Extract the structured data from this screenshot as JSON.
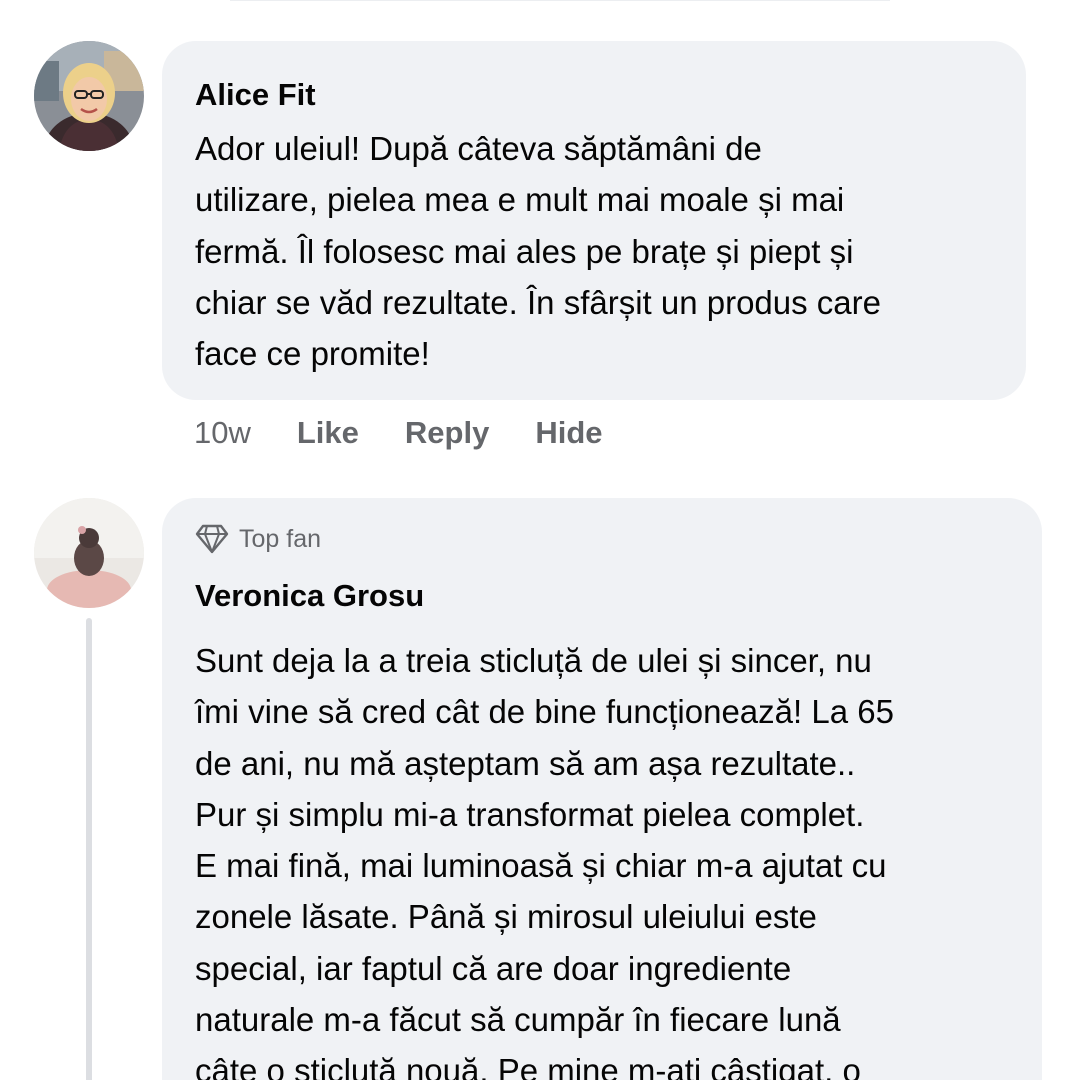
{
  "comments": [
    {
      "author": "Alice Fit",
      "text_lines": [
        "Ador uleiul! După câteva săptămâni de",
        "utilizare, pielea mea e mult mai moale și mai",
        "fermă. Îl folosesc mai ales pe brațe și piept și",
        "chiar se văd rezultate. În sfârșit un produs care",
        "face ce promite!"
      ],
      "time": "10w",
      "actions": {
        "like": "Like",
        "reply": "Reply",
        "hide": "Hide"
      },
      "avatar_icon": "avatar-woman-glasses"
    },
    {
      "badge": {
        "icon": "diamond-icon",
        "label": "Top fan"
      },
      "author": "Veronica Grosu",
      "text_lines": [
        "Sunt deja la a treia sticluță de ulei și sincer, nu",
        "îmi vine să cred cât de bine funcționează! La 65",
        "de ani, nu mă așteptam să am așa rezultate..",
        "Pur și simplu mi-a transformat pielea complet.",
        "E mai fină, mai luminoasă și chiar m-a ajutat cu",
        "zonele lăsate. Până și mirosul uleiului este",
        "special, iar faptul că are doar ingrediente",
        "naturale m-a făcut să cumpăr în fiecare lună",
        "câte o sticluță nouă. Pe mine m-ați câștigat, o"
      ],
      "avatar_icon": "avatar-child-photo"
    }
  ],
  "colors": {
    "bubble_bg": "#f0f2f5",
    "text": "#050505",
    "secondary_text": "#65676b",
    "thread_line": "#dcdee2"
  }
}
